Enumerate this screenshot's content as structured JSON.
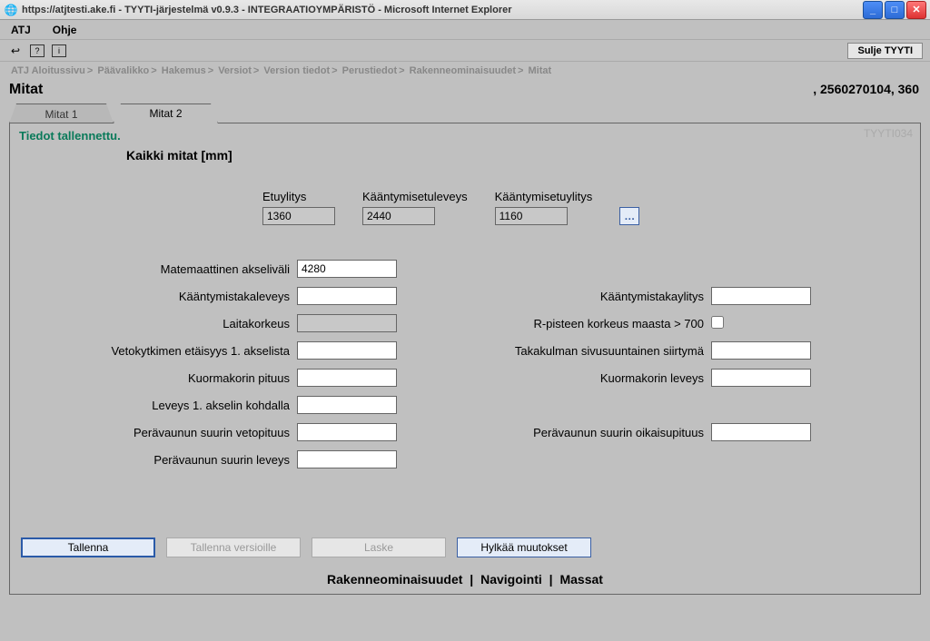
{
  "window": {
    "title": "https://atjtesti.ake.fi - TYYTI-järjestelmä v0.9.3 - INTEGRAATIOYMPÄRISTÖ - Microsoft Internet Explorer"
  },
  "menubar": {
    "atj": "ATJ",
    "ohje": "Ohje"
  },
  "toolbar": {
    "close_button": "Sulje TYYTI"
  },
  "breadcrumbs": {
    "items": [
      "ATJ Aloitussivu",
      "Päävalikko",
      "Hakemus",
      "Versiot",
      "Version tiedot",
      "Perustiedot",
      "Rakenneominaisuudet",
      "Mitat"
    ]
  },
  "page": {
    "title": "Mitat",
    "id_label": ", 2560270104, 360"
  },
  "tabs": {
    "t1": "Mitat 1",
    "t2": "Mitat 2"
  },
  "panel": {
    "status": "Tiedot tallennettu.",
    "code": "TYYTI034",
    "section_title": "Kaikki mitat [mm]"
  },
  "top_fields": {
    "etuylitys": {
      "label": "Etuylitys",
      "value": "1360"
    },
    "kaantymisetuleveys": {
      "label": "Kääntymisetuleveys",
      "value": "2440"
    },
    "kaantymisetuylitys": {
      "label": "Kääntymisetuylitys",
      "value": "1160"
    }
  },
  "form": {
    "matemaattinen_akselivali": {
      "label": "Matemaattinen akseliväli",
      "value": "4280"
    },
    "kaantymistakaleveys": {
      "label": "Kääntymistakaleveys",
      "value": ""
    },
    "kaantymistakaylitys": {
      "label": "Kääntymistakaylitys",
      "value": ""
    },
    "laitakorkeus": {
      "label": "Laitakorkeus",
      "value": ""
    },
    "rpiste": {
      "label": "R-pisteen korkeus maasta > 700"
    },
    "vetokytkimen": {
      "label": "Vetokytkimen etäisyys 1. akselista",
      "value": ""
    },
    "takakulman": {
      "label": "Takakulman sivusuuntainen siirtymä",
      "value": ""
    },
    "kuormakorin_pituus": {
      "label": "Kuormakorin pituus",
      "value": ""
    },
    "kuormakorin_leveys": {
      "label": "Kuormakorin leveys",
      "value": ""
    },
    "leveys1": {
      "label": "Leveys 1. akselin kohdalla",
      "value": ""
    },
    "peravaunu_veto": {
      "label": "Perävaunun suurin vetopituus",
      "value": ""
    },
    "peravaunu_oikaisu": {
      "label": "Perävaunun suurin oikaisupituus",
      "value": ""
    },
    "peravaunu_leveys": {
      "label": "Perävaunun suurin leveys",
      "value": ""
    }
  },
  "buttons": {
    "save": "Tallenna",
    "save_versions": "Tallenna versioille",
    "calc": "Laske",
    "reject": "Hylkää muutokset"
  },
  "footer": {
    "rak": "Rakenneominaisuudet",
    "nav": "Navigointi",
    "mas": "Massat",
    "sep": "|"
  }
}
